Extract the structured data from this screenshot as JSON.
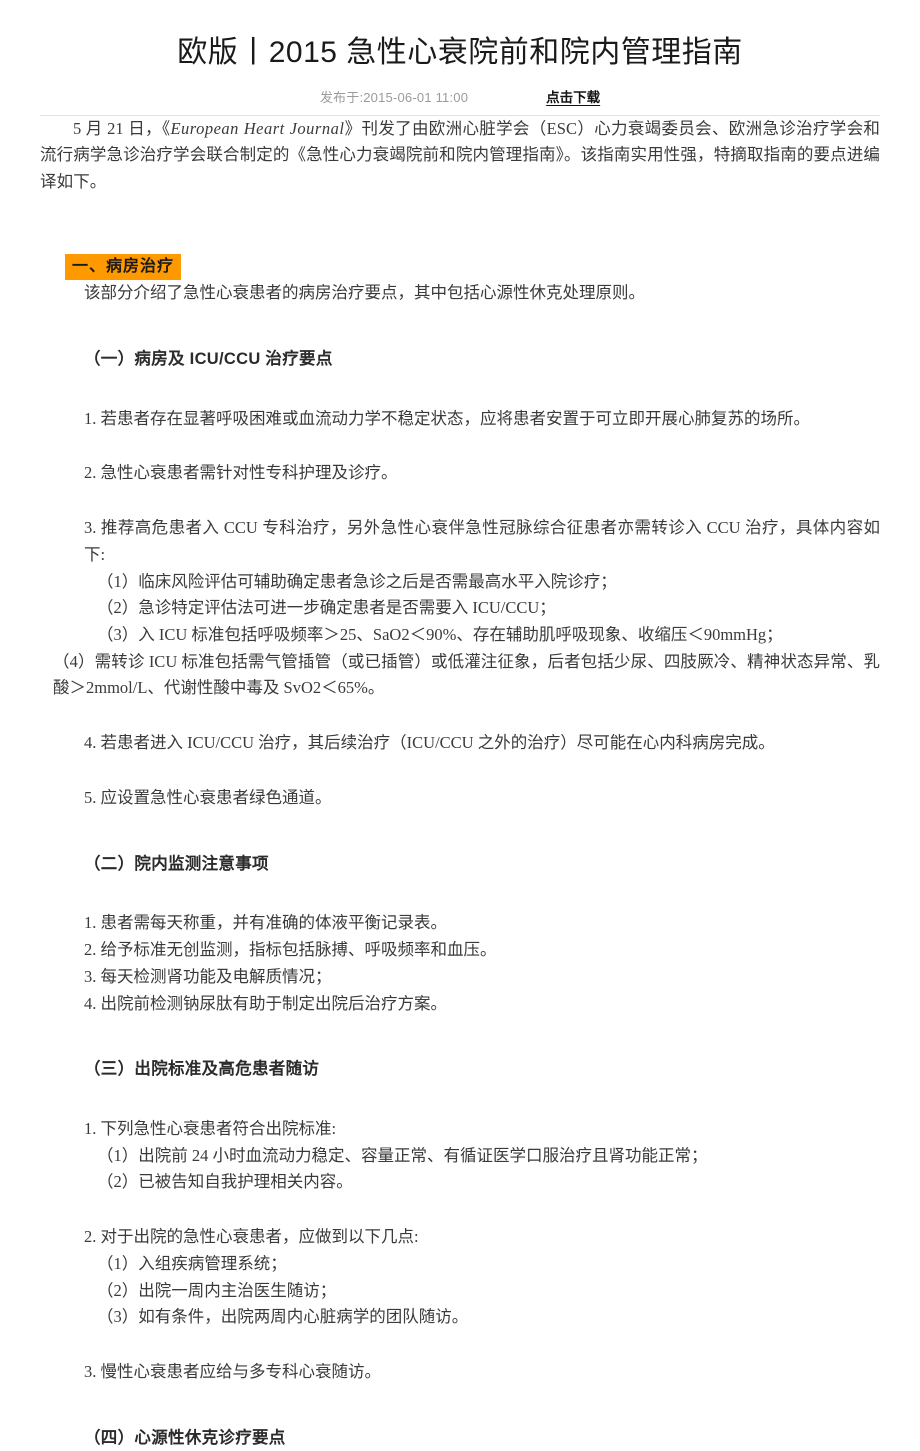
{
  "header": {
    "title": "欧版丨2015 急性心衰院前和院内管理指南",
    "published": "发布于:2015-06-01 11:00",
    "download_label": "点击下载"
  },
  "intro": {
    "before_journal": "5 月 21 日，《",
    "journal": "European Heart Journal",
    "after_journal": "》刊发了由欧洲心脏学会（ESC）心力衰竭委员会、欧洲急诊治疗学会和流行病学急诊治疗学会联合制定的《急性心力衰竭院前和院内管理指南》。该指南实用性强，特摘取指南的要点进编译如下。"
  },
  "section": {
    "heading": "一、病房治疗",
    "lead": "该部分介绍了急性心衰患者的病房治疗要点，其中包括心源性休克处理原则。"
  },
  "sub1": {
    "heading": "（一）病房及 ICU/CCU 治疗要点",
    "item1": "1. 若患者存在显著呼吸困难或血流动力学不稳定状态，应将患者安置于可立即开展心肺复苏的场所。",
    "item2": "2. 急性心衰患者需针对性专科护理及诊疗。",
    "item3": "3. 推荐高危患者入 CCU 专科治疗，另外急性心衰伴急性冠脉综合征患者亦需转诊入 CCU 治疗，具体内容如下:",
    "item3_1": "（1）临床风险评估可辅助确定患者急诊之后是否需最高水平入院诊疗；",
    "item3_2": "（2）急诊特定评估法可进一步确定患者是否需要入 ICU/CCU；",
    "item3_3": "（3）入 ICU 标准包括呼吸频率＞25、SaO2＜90%、存在辅助肌呼吸现象、收缩压＜90mmHg；",
    "item3_4": "（4）需转诊 ICU 标准包括需气管插管（或已插管）或低灌注征象，后者包括少尿、四肢厥冷、精神状态异常、乳酸＞2mmol/L、代谢性酸中毒及 SvO2＜65%。",
    "item4": "4. 若患者进入 ICU/CCU 治疗，其后续治疗（ICU/CCU 之外的治疗）尽可能在心内科病房完成。",
    "item5": "5. 应设置急性心衰患者绿色通道。"
  },
  "sub2": {
    "heading": "（二）院内监测注意事项",
    "item1": "1. 患者需每天称重，并有准确的体液平衡记录表。",
    "item2": "2. 给予标准无创监测，指标包括脉搏、呼吸频率和血压。",
    "item3": "3. 每天检测肾功能及电解质情况；",
    "item4": "4. 出院前检测钠尿肽有助于制定出院后治疗方案。"
  },
  "sub3": {
    "heading": "（三）出院标准及高危患者随访",
    "item1": "1. 下列急性心衰患者符合出院标准:",
    "item1_1": "（1）出院前 24 小时血流动力稳定、容量正常、有循证医学口服治疗且肾功能正常；",
    "item1_2": "（2）已被告知自我护理相关内容。",
    "item2": "2. 对于出院的急性心衰患者，应做到以下几点:",
    "item2_1": "（1）入组疾病管理系统；",
    "item2_2": "（2）出院一周内主治医生随访；",
    "item2_3": "（3）如有条件，出院两周内心脏病学的团队随访。",
    "item3": "3. 慢性心衰患者应给与多专科心衰随访。"
  },
  "sub4": {
    "heading": "（四）心源性休克诊疗要点"
  }
}
